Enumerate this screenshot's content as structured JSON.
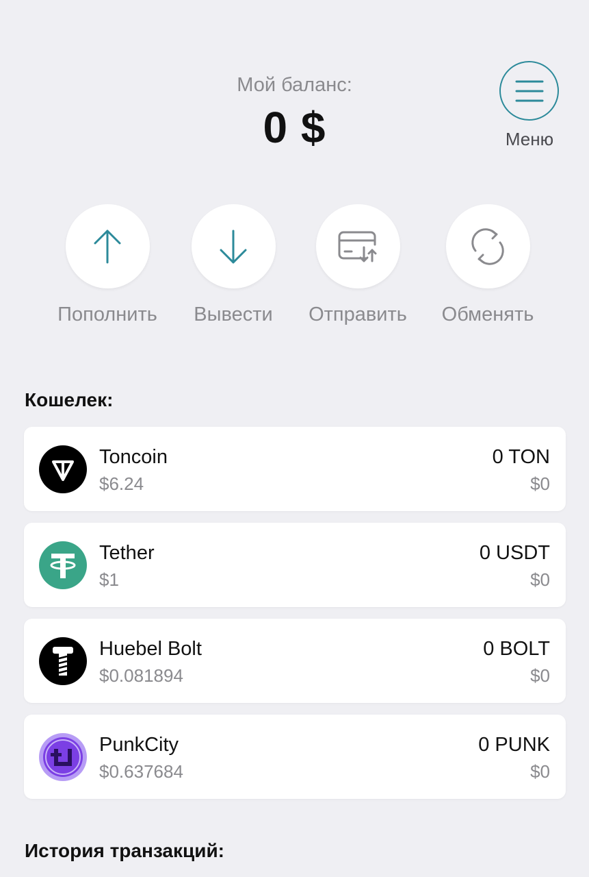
{
  "header": {
    "balance_label": "Мой баланс:",
    "balance_value": "0 $",
    "menu_label": "Меню"
  },
  "actions": [
    {
      "label": "Пополнить",
      "icon": "arrow-up-icon"
    },
    {
      "label": "Вывести",
      "icon": "arrow-down-icon"
    },
    {
      "label": "Отправить",
      "icon": "card-transfer-icon"
    },
    {
      "label": "Обменять",
      "icon": "exchange-icon"
    }
  ],
  "wallet": {
    "title": "Кошелек:",
    "items": [
      {
        "name": "Toncoin",
        "price": "$6.24",
        "amount": "0 TON",
        "value": "$0",
        "icon": "toncoin-logo-icon",
        "color": "#000000"
      },
      {
        "name": "Tether",
        "price": "$1",
        "amount": "0 USDT",
        "value": "$0",
        "icon": "tether-logo-icon",
        "color": "#3aa588"
      },
      {
        "name": "Huebel Bolt",
        "price": "$0.081894",
        "amount": "0 BOLT",
        "value": "$0",
        "icon": "bolt-logo-icon",
        "color": "#000000"
      },
      {
        "name": "PunkCity",
        "price": "$0.637684",
        "amount": "0 PUNK",
        "value": "$0",
        "icon": "punkcity-logo-icon",
        "color": "#7b3fe4"
      }
    ]
  },
  "history": {
    "title": "История транзакций:"
  },
  "colors": {
    "accent": "#2c8a9a",
    "background": "#efeff3",
    "muted_text": "#8a8a8e"
  }
}
